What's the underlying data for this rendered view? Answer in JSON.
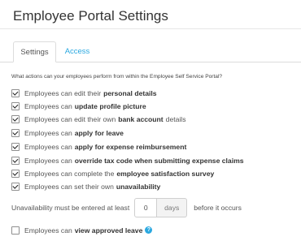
{
  "page": {
    "title": "Employee Portal Settings"
  },
  "tabs": [
    {
      "label": "Settings"
    },
    {
      "label": "Access"
    }
  ],
  "question": "What actions can your employees perform from within the Employee Self Service Portal?",
  "options": [
    {
      "checked": true,
      "pre": "Employees can edit their",
      "bold": "personal details",
      "post": ""
    },
    {
      "checked": true,
      "pre": "Employees can",
      "bold": "update profile picture",
      "post": ""
    },
    {
      "checked": true,
      "pre": "Employees can edit their own",
      "bold": "bank account",
      "post": "details"
    },
    {
      "checked": true,
      "pre": "Employees can",
      "bold": "apply for leave",
      "post": ""
    },
    {
      "checked": true,
      "pre": "Employees can",
      "bold": "apply for expense reimbursement",
      "post": ""
    },
    {
      "checked": true,
      "pre": "Employees can",
      "bold": "override tax code when submitting expense claims",
      "post": ""
    },
    {
      "checked": true,
      "pre": "Employees can complete the",
      "bold": "employee satisfaction survey",
      "post": ""
    },
    {
      "checked": true,
      "pre": "Employees can set their own",
      "bold": "unavailability",
      "post": ""
    }
  ],
  "unavailability": {
    "before": "Unavailability must be entered at least",
    "value": "0",
    "unit": "days",
    "after": "before it occurs"
  },
  "view_leave": {
    "checked": false,
    "pre": "Employees can",
    "bold": "view approved leave",
    "help_icon": "question-circle-icon"
  }
}
